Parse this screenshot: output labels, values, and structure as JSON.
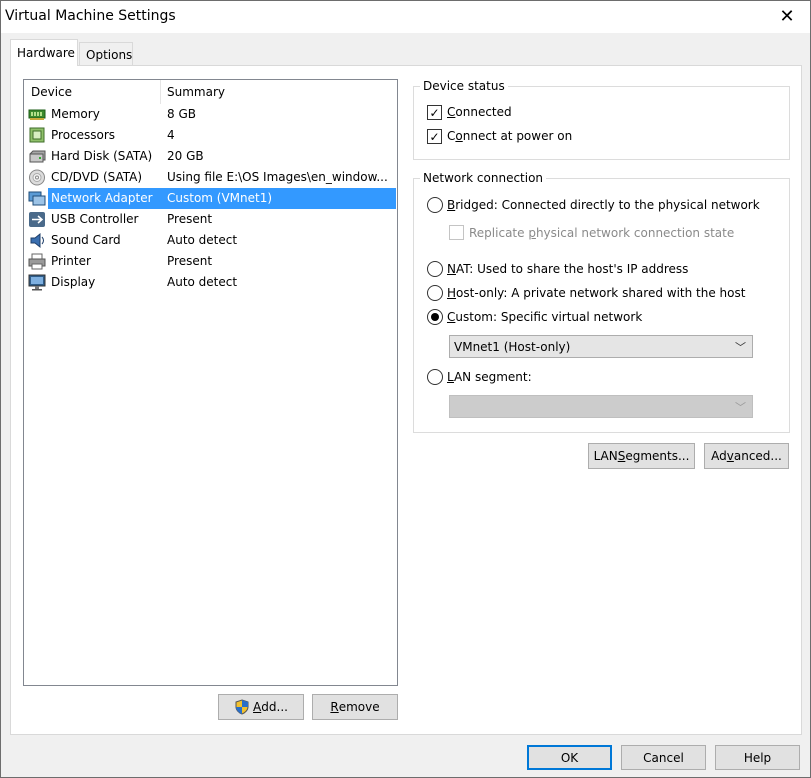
{
  "window": {
    "title": "Virtual Machine Settings",
    "close_symbol": "✕"
  },
  "tabs": [
    {
      "label": "Hardware",
      "active": true
    },
    {
      "label": "Options",
      "active": false
    }
  ],
  "device_list": {
    "columns": [
      "Device",
      "Summary"
    ],
    "rows": [
      {
        "device": "Memory",
        "summary": "8 GB",
        "icon": "memory-icon",
        "selected": false
      },
      {
        "device": "Processors",
        "summary": "4",
        "icon": "processor-icon",
        "selected": false
      },
      {
        "device": "Hard Disk (SATA)",
        "summary": "20 GB",
        "icon": "hard-disk-icon",
        "selected": false
      },
      {
        "device": "CD/DVD (SATA)",
        "summary": "Using file E:\\OS Images\\en_window...",
        "icon": "cd-dvd-icon",
        "selected": false
      },
      {
        "device": "Network Adapter",
        "summary": "Custom (VMnet1)",
        "icon": "network-adapter-icon",
        "selected": true
      },
      {
        "device": "USB Controller",
        "summary": "Present",
        "icon": "usb-icon",
        "selected": false
      },
      {
        "device": "Sound Card",
        "summary": "Auto detect",
        "icon": "speaker-icon",
        "selected": false
      },
      {
        "device": "Printer",
        "summary": "Present",
        "icon": "printer-icon",
        "selected": false
      },
      {
        "device": "Display",
        "summary": "Auto detect",
        "icon": "monitor-icon",
        "selected": false
      }
    ]
  },
  "list_buttons": {
    "add_mnemonic": "A",
    "add_rest": "dd...",
    "add_icon": "shield-icon",
    "remove_mnemonic": "R",
    "remove_rest": "emove"
  },
  "device_status": {
    "title": "Device status",
    "connected_mnemonic": "C",
    "connected_rest": "onnected",
    "connected_checked": true,
    "power_on_pre": "C",
    "power_on_mnemonic": "o",
    "power_on_rest": "nnect at power on",
    "power_on_checked": true
  },
  "network_connection": {
    "title": "Network connection",
    "bridged_mnemonic": "B",
    "bridged_rest": "ridged: Connected directly to the physical network",
    "replicate_pre": "Replicate ",
    "replicate_mnemonic": "p",
    "replicate_rest": "hysical network connection state",
    "replicate_checked": false,
    "nat_mnemonic": "N",
    "nat_rest": "AT: Used to share the host's IP address",
    "hostonly_mnemonic": "H",
    "hostonly_rest": "ost-only: A private network shared with the host",
    "custom_mnemonic": "C",
    "custom_rest": "ustom: Specific virtual network",
    "selected_option": "custom",
    "custom_value": "VMnet1 (Host-only)",
    "lan_mnemonic": "L",
    "lan_rest": "AN segment:",
    "lan_value": ""
  },
  "right_buttons": {
    "lan_segments_pre": "LAN ",
    "lan_segments_mnemonic": "S",
    "lan_segments_rest": "egments...",
    "advanced_pre": "Ad",
    "advanced_mnemonic": "v",
    "advanced_rest": "anced..."
  },
  "footer": {
    "ok": "OK",
    "cancel": "Cancel",
    "help": "Help"
  },
  "colors": {
    "selection": "#3399ff",
    "default_button_border": "#0078d7"
  }
}
